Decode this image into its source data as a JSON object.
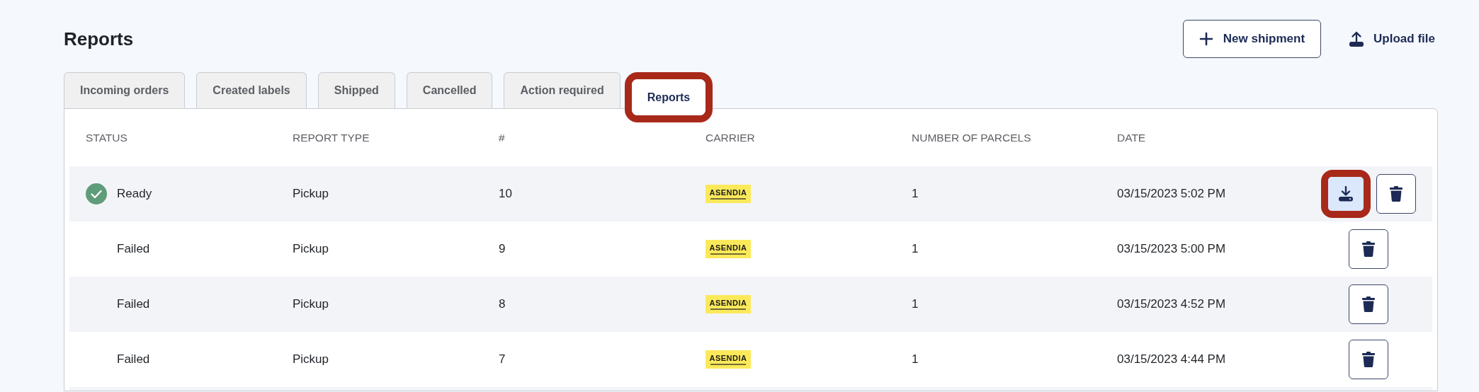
{
  "page": {
    "title": "Reports"
  },
  "header_actions": [
    {
      "kind": "outlined",
      "label": "New shipment"
    },
    {
      "kind": "plain",
      "label": "Upload file"
    }
  ],
  "tabs": [
    {
      "label": "Incoming orders",
      "selected": false,
      "highlighted": false
    },
    {
      "label": "Created labels",
      "selected": false,
      "highlighted": false
    },
    {
      "label": "Shipped",
      "selected": false,
      "highlighted": false
    },
    {
      "label": "Cancelled",
      "selected": false,
      "highlighted": false
    },
    {
      "label": "Action required",
      "selected": false,
      "highlighted": false
    },
    {
      "label": "Reports",
      "selected": true,
      "highlighted": true
    }
  ],
  "table": {
    "columns": [
      "STATUS",
      "REPORT TYPE",
      "#",
      "CARRIER",
      "NUMBER OF PARCELS",
      "DATE"
    ],
    "rows": [
      {
        "status": {
          "kind": "ready",
          "label": "Ready"
        },
        "report_type": "Pickup",
        "number": "10",
        "carrier": {
          "logo": "ASENDIA"
        },
        "parcels": "1",
        "date": "03/15/2023 5:02 PM",
        "download": {
          "highlighted": true
        }
      },
      {
        "status": {
          "kind": "failed",
          "label": "Failed"
        },
        "report_type": "Pickup",
        "number": "9",
        "carrier": {
          "logo": "ASENDIA"
        },
        "parcels": "1",
        "date": "03/15/2023 5:00 PM"
      },
      {
        "status": {
          "kind": "failed",
          "label": "Failed"
        },
        "report_type": "Pickup",
        "number": "8",
        "carrier": {
          "logo": "ASENDIA"
        },
        "parcels": "1",
        "date": "03/15/2023 4:52 PM"
      },
      {
        "status": {
          "kind": "failed",
          "label": "Failed"
        },
        "report_type": "Pickup",
        "number": "7",
        "carrier": {
          "logo": "ASENDIA"
        },
        "parcels": "1",
        "date": "03/15/2023 4:44 PM"
      }
    ]
  }
}
